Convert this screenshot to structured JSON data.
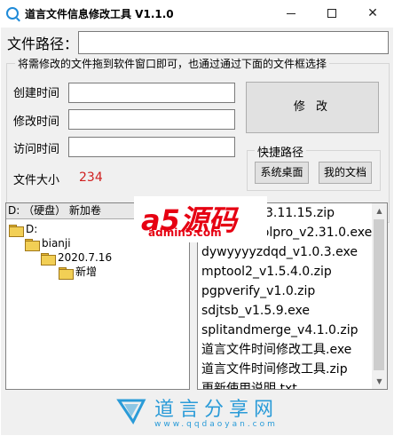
{
  "window": {
    "title": "道言文件信息修改工具 V1.1.0",
    "min_glyph": "—",
    "max_glyph": "☐",
    "close_glyph": "✕"
  },
  "path": {
    "label": "文件路径：",
    "value": ""
  },
  "group": {
    "title": "将需修改的文件拖到软件窗口即可，也通过通过下面的文件框选择"
  },
  "fields": {
    "created_label": "创建时间",
    "created_value": "",
    "modified_label": "修改时间",
    "modified_value": "",
    "accessed_label": "访问时间",
    "accessed_value": "",
    "size_label": "文件大小",
    "size_value": "234"
  },
  "modify_button": "修 改",
  "shortcut": {
    "title": "快捷路径",
    "desktop_button": "系统桌面",
    "documents_button": "我的文档"
  },
  "drive": {
    "selected": "D: （硬盘） 新加卷"
  },
  "tree": {
    "items": [
      "D:",
      "bianji",
      "2020.7.16",
      "新增"
    ]
  },
  "files": [
    "3.11.15.zip",
    "ntrolpro_v2.31.0.exe",
    "dywyyyyzdqd_v1.0.3.exe",
    "mptool2_v1.5.4.0.zip",
    "pgpverify_v1.0.zip",
    "sdjtsb_v1.5.9.exe",
    "splitandmerge_v4.1.0.zip",
    "道言文件时间修改工具.exe",
    "道言文件时间修改工具.zip",
    "更新使用说明.txt"
  ],
  "watermarks": {
    "a5_logo": "a5源码",
    "a5_site": "admin5.com",
    "daoyan_name": "道言分享网",
    "daoyan_url": "www.qqdaoyan.com"
  },
  "colors": {
    "accent": "#1e8ad8",
    "size_value": "#d02020",
    "watermark_red": "#e60012",
    "watermark_blue": "#2a9bd8"
  },
  "icons": {
    "app": "search-icon",
    "tree_node": "folder-icon",
    "scroll_up": "chevron-up-icon",
    "scroll_down": "chevron-down-icon"
  }
}
